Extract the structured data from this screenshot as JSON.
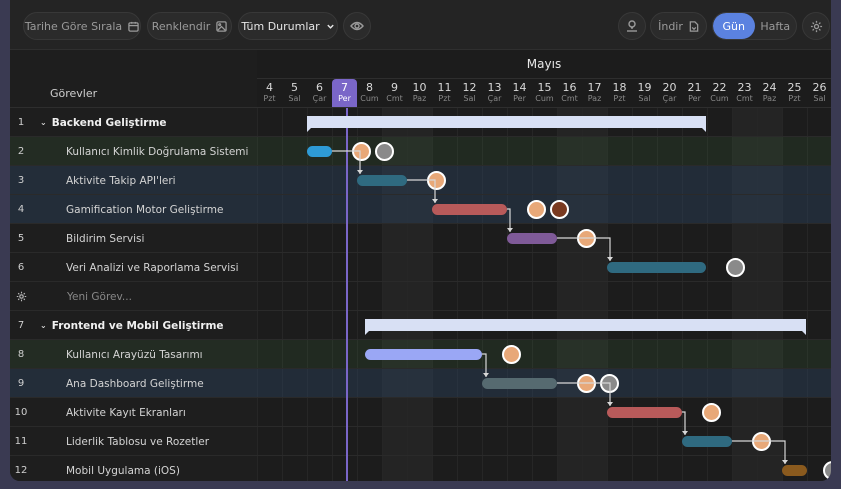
{
  "toolbar": {
    "sort_label": "Tarihe Göre Sırala",
    "color_label": "Renklendir",
    "status_label": "Tüm Durumlar",
    "download_label": "İndir",
    "view_day": "Gün",
    "view_week": "Hafta"
  },
  "header": {
    "tasks_label": "Görevler",
    "month": "Mayıs"
  },
  "days": [
    {
      "n": "4",
      "w": "Pzt"
    },
    {
      "n": "5",
      "w": "Sal"
    },
    {
      "n": "6",
      "w": "Çar"
    },
    {
      "n": "7",
      "w": "Per",
      "today": true
    },
    {
      "n": "8",
      "w": "Cum"
    },
    {
      "n": "9",
      "w": "Cmt"
    },
    {
      "n": "10",
      "w": "Paz"
    },
    {
      "n": "11",
      "w": "Pzt"
    },
    {
      "n": "12",
      "w": "Sal"
    },
    {
      "n": "13",
      "w": "Çar"
    },
    {
      "n": "14",
      "w": "Per"
    },
    {
      "n": "15",
      "w": "Cum"
    },
    {
      "n": "16",
      "w": "Cmt"
    },
    {
      "n": "17",
      "w": "Paz"
    },
    {
      "n": "18",
      "w": "Pzt"
    },
    {
      "n": "19",
      "w": "Sal"
    },
    {
      "n": "20",
      "w": "Çar"
    },
    {
      "n": "21",
      "w": "Per"
    },
    {
      "n": "22",
      "w": "Cum"
    },
    {
      "n": "23",
      "w": "Cmt"
    },
    {
      "n": "24",
      "w": "Paz"
    },
    {
      "n": "25",
      "w": "Pzt"
    },
    {
      "n": "26",
      "w": "Sal"
    }
  ],
  "rows": [
    {
      "num": "1",
      "label": "Backend Geliştirme",
      "type": "group"
    },
    {
      "num": "2",
      "label": "Kullanıcı Kimlik Doğrulama Sistemi",
      "type": "task"
    },
    {
      "num": "3",
      "label": "Aktivite Takip API'leri",
      "type": "task"
    },
    {
      "num": "4",
      "label": "Gamification Motor Geliştirme",
      "type": "task"
    },
    {
      "num": "5",
      "label": "Bildirim Servisi",
      "type": "task"
    },
    {
      "num": "6",
      "label": "Veri Analizi ve Raporlama Servisi",
      "type": "task"
    },
    {
      "num": "",
      "label": "Yeni Görev...",
      "type": "new"
    },
    {
      "num": "7",
      "label": "Frontend ve Mobil Geliştirme",
      "type": "group"
    },
    {
      "num": "8",
      "label": "Kullanıcı Arayüzü Tasarımı",
      "type": "task"
    },
    {
      "num": "9",
      "label": "Ana Dashboard Geliştirme",
      "type": "task"
    },
    {
      "num": "10",
      "label": "Aktivite Kayıt Ekranları",
      "type": "task"
    },
    {
      "num": "11",
      "label": "Liderlik Tablosu ve Rozetler",
      "type": "task"
    },
    {
      "num": "12",
      "label": "Mobil Uygulama (iOS)",
      "type": "task"
    }
  ],
  "colors": {
    "accent": "#5b82e0",
    "today": "#7a66c8",
    "bar_blue": "#2e9bd6",
    "bar_teal": "#2f6a80",
    "bar_red": "#b85a5a",
    "bar_purple": "#7f5a98",
    "bar_lavender": "#9aa7f5",
    "bar_gray": "#566a70",
    "bar_brown": "#8a5a1e"
  }
}
